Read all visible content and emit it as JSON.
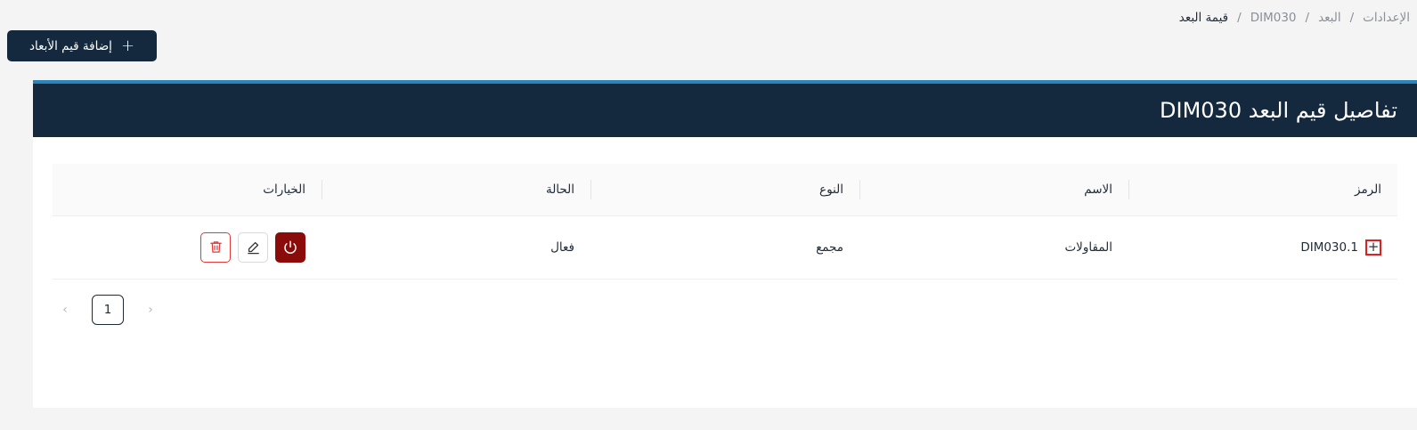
{
  "breadcrumb": {
    "items": [
      "الإعدادات",
      "البعد",
      "DIM030"
    ],
    "current": "قيمة البعد"
  },
  "toolbar": {
    "add_label": "إضافة قيم الأبعاد"
  },
  "card": {
    "title": "تفاصيل قيم البعد DIM030"
  },
  "table": {
    "columns": [
      "الرمز",
      "الاسم",
      "النوع",
      "الحالة",
      "الخيارات"
    ],
    "rows": [
      {
        "code": "DIM030.1",
        "name": "المقاولات",
        "type": "مجمع",
        "status": "فعال"
      }
    ]
  },
  "pagination": {
    "current_page": "1"
  },
  "colors": {
    "primary": "#14293d",
    "accent_border": "#2a86b8",
    "power_button": "#8b0a0a",
    "delete_red": "#e03a3a"
  }
}
